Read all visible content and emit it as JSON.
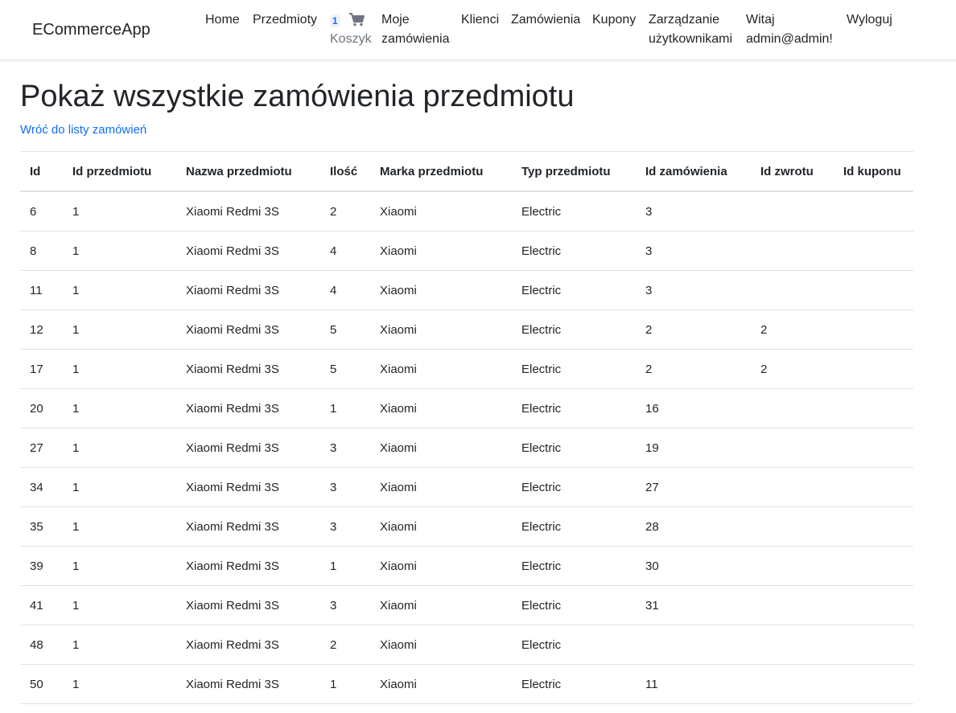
{
  "navbar": {
    "brand": "ECommerceApp",
    "home": "Home",
    "items": "Przedmioty",
    "cart": {
      "count": "1",
      "label": "Koszyk",
      "icon": "cart-icon"
    },
    "my_orders": [
      "Moje",
      "zamówienia"
    ],
    "customers": "Klienci",
    "orders": "Zamówienia",
    "coupons": "Kupony",
    "user_management": [
      "Zarządzanie",
      "użytkownikami"
    ],
    "greeting": [
      "Witaj",
      "admin@admin!"
    ],
    "logout": "Wyloguj"
  },
  "page": {
    "title": "Pokaż wszystkie zamówienia przedmiotu",
    "back_link": "Wróć do listy zamówień"
  },
  "table": {
    "headers": [
      "Id",
      "Id przedmiotu",
      "Nazwa przedmiotu",
      "Ilość",
      "Marka przedmiotu",
      "Typ przedmiotu",
      "Id zamówienia",
      "Id zwrotu",
      "Id kuponu"
    ],
    "rows": [
      [
        "6",
        "1",
        "Xiaomi Redmi 3S",
        "2",
        "Xiaomi",
        "Electric",
        "3",
        "",
        ""
      ],
      [
        "8",
        "1",
        "Xiaomi Redmi 3S",
        "4",
        "Xiaomi",
        "Electric",
        "3",
        "",
        ""
      ],
      [
        "11",
        "1",
        "Xiaomi Redmi 3S",
        "4",
        "Xiaomi",
        "Electric",
        "3",
        "",
        ""
      ],
      [
        "12",
        "1",
        "Xiaomi Redmi 3S",
        "5",
        "Xiaomi",
        "Electric",
        "2",
        "2",
        ""
      ],
      [
        "17",
        "1",
        "Xiaomi Redmi 3S",
        "5",
        "Xiaomi",
        "Electric",
        "2",
        "2",
        ""
      ],
      [
        "20",
        "1",
        "Xiaomi Redmi 3S",
        "1",
        "Xiaomi",
        "Electric",
        "16",
        "",
        ""
      ],
      [
        "27",
        "1",
        "Xiaomi Redmi 3S",
        "3",
        "Xiaomi",
        "Electric",
        "19",
        "",
        ""
      ],
      [
        "34",
        "1",
        "Xiaomi Redmi 3S",
        "3",
        "Xiaomi",
        "Electric",
        "27",
        "",
        ""
      ],
      [
        "35",
        "1",
        "Xiaomi Redmi 3S",
        "3",
        "Xiaomi",
        "Electric",
        "28",
        "",
        ""
      ],
      [
        "39",
        "1",
        "Xiaomi Redmi 3S",
        "1",
        "Xiaomi",
        "Electric",
        "30",
        "",
        ""
      ],
      [
        "41",
        "1",
        "Xiaomi Redmi 3S",
        "3",
        "Xiaomi",
        "Electric",
        "31",
        "",
        ""
      ],
      [
        "48",
        "1",
        "Xiaomi Redmi 3S",
        "2",
        "Xiaomi",
        "Electric",
        "",
        "",
        ""
      ],
      [
        "50",
        "1",
        "Xiaomi Redmi 3S",
        "1",
        "Xiaomi",
        "Electric",
        "11",
        "",
        ""
      ]
    ]
  },
  "colors": {
    "link": "#0d6efd",
    "text": "#212529",
    "muted": "#6c757d",
    "border": "#dee2e6"
  }
}
